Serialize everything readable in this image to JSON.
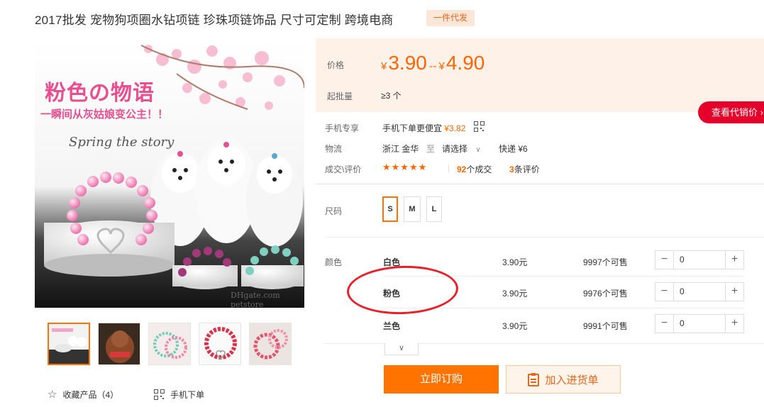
{
  "product": {
    "title": "2017批发 宠物狗项圈水钻项链 珍珠项链饰品 尺寸可定制 跨境电商",
    "tag": "一件代发"
  },
  "main_image": {
    "headline": "粉色の物语",
    "subline": "一瞬间从灰姑娘变公主！！",
    "spring_text": "Spring the story",
    "brand_text": "DHgate.com petstore"
  },
  "price_panel": {
    "price_label": "价格",
    "currency": "¥",
    "price_low": "3.90",
    "range_sep": "--",
    "price_high": "4.90",
    "moq_label": "起批量",
    "moq_value": "≥3 个"
  },
  "agent_button": "查看代销价 ›",
  "mobile": {
    "label": "手机专享",
    "text": "手机下单更便宜",
    "price": "¥3.82"
  },
  "logistics": {
    "label": "物流",
    "origin": "浙江 金华",
    "to": "至",
    "destination": "请选择",
    "express": "快递 ¥6"
  },
  "deals": {
    "label": "成交\\评价",
    "stars": "★★★★★",
    "sales_count": "92",
    "sales_suffix": "个成交",
    "review_count": "3",
    "review_suffix": "条评价"
  },
  "size": {
    "label": "尺码",
    "options": [
      "S",
      "M",
      "L"
    ],
    "selected": "S"
  },
  "color": {
    "label": "颜色",
    "rows": [
      {
        "name": "白色",
        "price": "3.90元",
        "stock": "9997个可售",
        "qty": "0"
      },
      {
        "name": "粉色",
        "price": "3.90元",
        "stock": "9976个可售",
        "qty": "0"
      },
      {
        "name": "兰色",
        "price": "3.90元",
        "stock": "9991个可售",
        "qty": "0"
      }
    ],
    "minus": "−",
    "plus": "+"
  },
  "actions": {
    "buy": "立即订购",
    "cart": "加入进货单"
  },
  "bottom": {
    "favorite": "收藏产品（4）",
    "mobile_order": "手机下单"
  },
  "colors": {
    "accent": "#ff7300",
    "price": "#ff6600",
    "agent_red": "#e4002b",
    "annotation_red": "#e8202a",
    "panel_bg": "#fdf1e8"
  }
}
